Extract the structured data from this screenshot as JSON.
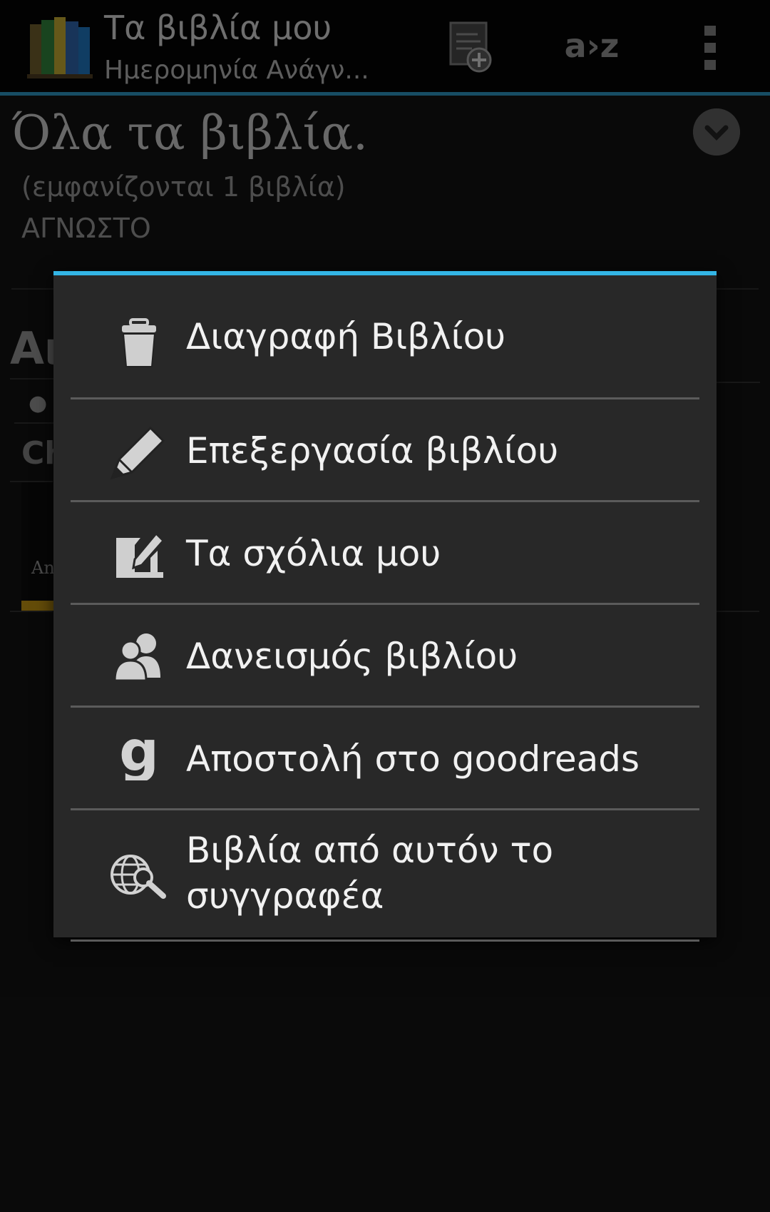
{
  "action_bar": {
    "title": "Τα βιβλία μου",
    "subtitle": "Ημερομηνία Ανάγν...",
    "sort_label": "a›z",
    "icons": [
      "app-books-icon",
      "add-book-icon",
      "overflow-menu-icon"
    ]
  },
  "list_header": {
    "filter_title": "Όλα τα βιβλία.",
    "count_text": "(εμφανίζονται 1 βιβλία)",
    "group_text": "ΑΓΝΩΣΤΟ"
  },
  "background_list": {
    "author_heading_partial": "Αι",
    "series_partial": "● ,",
    "book_title_partial": "Ch",
    "cover_text_partial": "Anc"
  },
  "context_menu": {
    "accent_color": "#33b5e5",
    "items": [
      {
        "label": "Διαγραφή Βιβλίου",
        "icon": "trash-icon"
      },
      {
        "label": "Επεξεργασία βιβλίου",
        "icon": "pencil-icon"
      },
      {
        "label": "Τα σχόλια μου",
        "icon": "notes-edit-icon"
      },
      {
        "label": "Δανεισμός βιβλίου",
        "icon": "people-icon"
      },
      {
        "label": "Αποστολή στο goodreads",
        "icon": "goodreads-icon"
      },
      {
        "label_line1": "Βιβλία από αυτόν το",
        "label_line2": "συγγραφέα",
        "icon": "web-search-icon"
      }
    ]
  }
}
